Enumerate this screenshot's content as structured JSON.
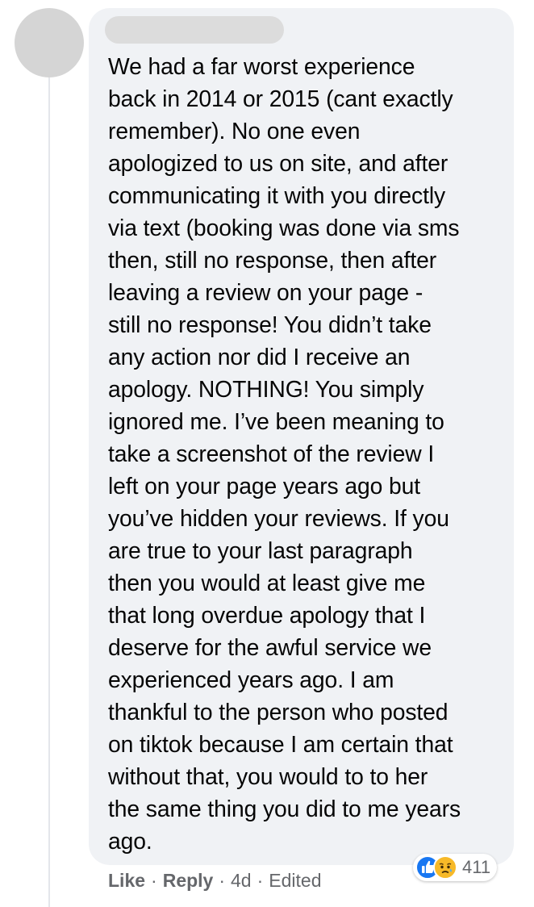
{
  "comment": {
    "author": "",
    "lines": [
      "We had a far worst experience",
      "back in 2014 or 2015 (cant exactly",
      "remember). No one even",
      "apologized to us on site, and after",
      "communicating it with you directly",
      "via text (booking was done via sms",
      "then, still no response, then after",
      "leaving a review on your page -",
      "still no response! You didn’t take",
      "any action nor did I receive an",
      "apology. NOTHING! You simply",
      "ignored me. I’ve been meaning to",
      "take a screenshot of the review I",
      "left on your page years ago but",
      "you’ve hidden your reviews. If you",
      "are true to your last paragraph",
      "then you would at least give me",
      "that long overdue apology that I",
      "deserve for the awful service we",
      "experienced years ago. I am",
      "thankful to the person who posted",
      "on tiktok because I am certain that",
      "without that, you would to to her",
      "the same thing you did to me years",
      "ago."
    ]
  },
  "actions": {
    "like": "Like",
    "separator": "·",
    "reply": "Reply",
    "time": "4d",
    "edited": "Edited"
  },
  "reactions": {
    "icons": [
      "like-icon",
      "sad-icon"
    ],
    "count": "411",
    "colors": {
      "like": "#1877f2",
      "sad": "#f7b928"
    }
  },
  "colors": {
    "bubble": "#f0f2f5",
    "text": "#050505",
    "meta": "#65676b"
  }
}
